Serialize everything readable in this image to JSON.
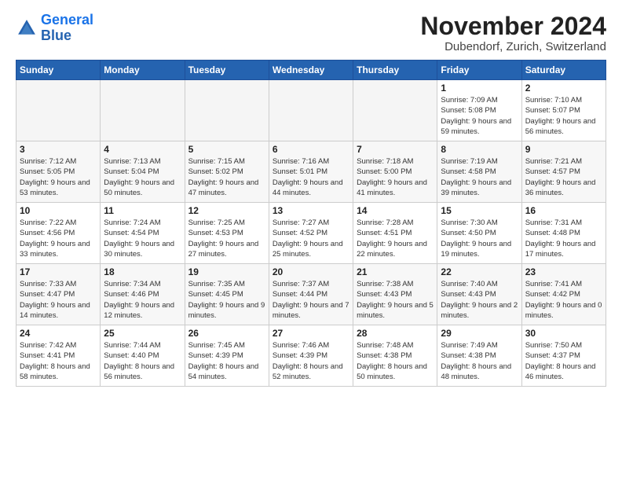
{
  "header": {
    "logo_line1": "General",
    "logo_line2": "Blue",
    "month_title": "November 2024",
    "location": "Dubendorf, Zurich, Switzerland"
  },
  "days_of_week": [
    "Sunday",
    "Monday",
    "Tuesday",
    "Wednesday",
    "Thursday",
    "Friday",
    "Saturday"
  ],
  "weeks": [
    [
      {
        "day": "",
        "empty": true
      },
      {
        "day": "",
        "empty": true
      },
      {
        "day": "",
        "empty": true
      },
      {
        "day": "",
        "empty": true
      },
      {
        "day": "",
        "empty": true
      },
      {
        "day": "1",
        "sunrise": "7:09 AM",
        "sunset": "5:08 PM",
        "daylight": "9 hours and 59 minutes."
      },
      {
        "day": "2",
        "sunrise": "7:10 AM",
        "sunset": "5:07 PM",
        "daylight": "9 hours and 56 minutes."
      }
    ],
    [
      {
        "day": "3",
        "sunrise": "7:12 AM",
        "sunset": "5:05 PM",
        "daylight": "9 hours and 53 minutes."
      },
      {
        "day": "4",
        "sunrise": "7:13 AM",
        "sunset": "5:04 PM",
        "daylight": "9 hours and 50 minutes."
      },
      {
        "day": "5",
        "sunrise": "7:15 AM",
        "sunset": "5:02 PM",
        "daylight": "9 hours and 47 minutes."
      },
      {
        "day": "6",
        "sunrise": "7:16 AM",
        "sunset": "5:01 PM",
        "daylight": "9 hours and 44 minutes."
      },
      {
        "day": "7",
        "sunrise": "7:18 AM",
        "sunset": "5:00 PM",
        "daylight": "9 hours and 41 minutes."
      },
      {
        "day": "8",
        "sunrise": "7:19 AM",
        "sunset": "4:58 PM",
        "daylight": "9 hours and 39 minutes."
      },
      {
        "day": "9",
        "sunrise": "7:21 AM",
        "sunset": "4:57 PM",
        "daylight": "9 hours and 36 minutes."
      }
    ],
    [
      {
        "day": "10",
        "sunrise": "7:22 AM",
        "sunset": "4:56 PM",
        "daylight": "9 hours and 33 minutes."
      },
      {
        "day": "11",
        "sunrise": "7:24 AM",
        "sunset": "4:54 PM",
        "daylight": "9 hours and 30 minutes."
      },
      {
        "day": "12",
        "sunrise": "7:25 AM",
        "sunset": "4:53 PM",
        "daylight": "9 hours and 27 minutes."
      },
      {
        "day": "13",
        "sunrise": "7:27 AM",
        "sunset": "4:52 PM",
        "daylight": "9 hours and 25 minutes."
      },
      {
        "day": "14",
        "sunrise": "7:28 AM",
        "sunset": "4:51 PM",
        "daylight": "9 hours and 22 minutes."
      },
      {
        "day": "15",
        "sunrise": "7:30 AM",
        "sunset": "4:50 PM",
        "daylight": "9 hours and 19 minutes."
      },
      {
        "day": "16",
        "sunrise": "7:31 AM",
        "sunset": "4:48 PM",
        "daylight": "9 hours and 17 minutes."
      }
    ],
    [
      {
        "day": "17",
        "sunrise": "7:33 AM",
        "sunset": "4:47 PM",
        "daylight": "9 hours and 14 minutes."
      },
      {
        "day": "18",
        "sunrise": "7:34 AM",
        "sunset": "4:46 PM",
        "daylight": "9 hours and 12 minutes."
      },
      {
        "day": "19",
        "sunrise": "7:35 AM",
        "sunset": "4:45 PM",
        "daylight": "9 hours and 9 minutes."
      },
      {
        "day": "20",
        "sunrise": "7:37 AM",
        "sunset": "4:44 PM",
        "daylight": "9 hours and 7 minutes."
      },
      {
        "day": "21",
        "sunrise": "7:38 AM",
        "sunset": "4:43 PM",
        "daylight": "9 hours and 5 minutes."
      },
      {
        "day": "22",
        "sunrise": "7:40 AM",
        "sunset": "4:43 PM",
        "daylight": "9 hours and 2 minutes."
      },
      {
        "day": "23",
        "sunrise": "7:41 AM",
        "sunset": "4:42 PM",
        "daylight": "9 hours and 0 minutes."
      }
    ],
    [
      {
        "day": "24",
        "sunrise": "7:42 AM",
        "sunset": "4:41 PM",
        "daylight": "8 hours and 58 minutes."
      },
      {
        "day": "25",
        "sunrise": "7:44 AM",
        "sunset": "4:40 PM",
        "daylight": "8 hours and 56 minutes."
      },
      {
        "day": "26",
        "sunrise": "7:45 AM",
        "sunset": "4:39 PM",
        "daylight": "8 hours and 54 minutes."
      },
      {
        "day": "27",
        "sunrise": "7:46 AM",
        "sunset": "4:39 PM",
        "daylight": "8 hours and 52 minutes."
      },
      {
        "day": "28",
        "sunrise": "7:48 AM",
        "sunset": "4:38 PM",
        "daylight": "8 hours and 50 minutes."
      },
      {
        "day": "29",
        "sunrise": "7:49 AM",
        "sunset": "4:38 PM",
        "daylight": "8 hours and 48 minutes."
      },
      {
        "day": "30",
        "sunrise": "7:50 AM",
        "sunset": "4:37 PM",
        "daylight": "8 hours and 46 minutes."
      }
    ]
  ]
}
